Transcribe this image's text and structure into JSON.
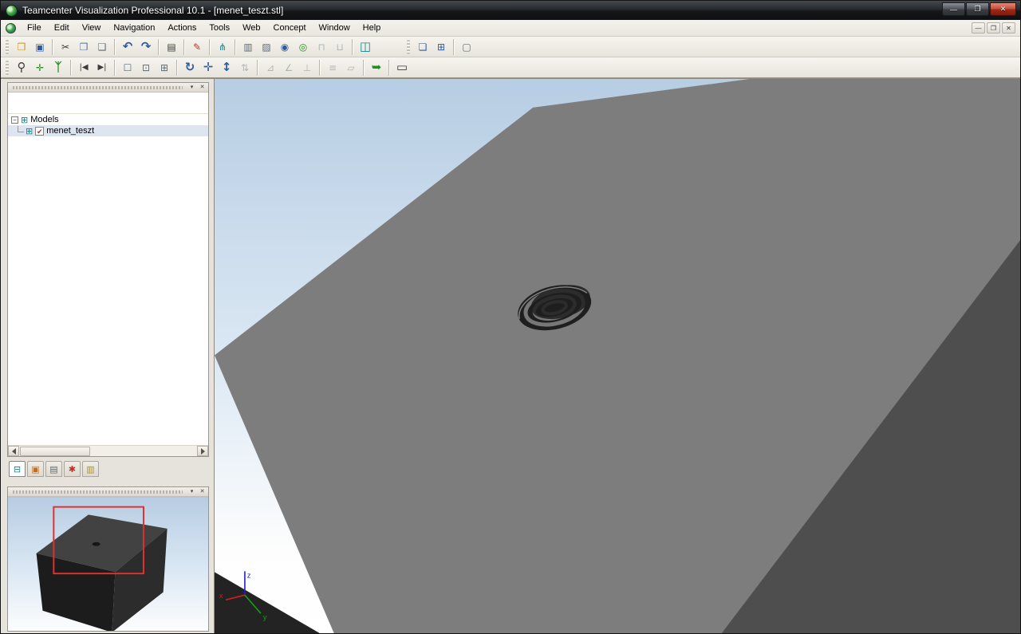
{
  "window": {
    "title": "Teamcenter Visualization Professional 10.1 - [menet_teszt.stl]",
    "controls": {
      "minimize": "—",
      "maximize": "❐",
      "close": "✕"
    }
  },
  "menu": {
    "items": [
      "File",
      "Edit",
      "View",
      "Navigation",
      "Actions",
      "Tools",
      "Web",
      "Concept",
      "Window",
      "Help"
    ],
    "mdi": {
      "minimize": "—",
      "restore": "❐",
      "close": "✕"
    }
  },
  "toolbar_main": {
    "buttons": [
      {
        "name": "open",
        "glyph": "❒"
      },
      {
        "name": "save",
        "glyph": "▣"
      },
      {
        "name": "cut",
        "glyph": "✂"
      },
      {
        "name": "copy",
        "glyph": "❐"
      },
      {
        "name": "paste",
        "glyph": "❑"
      },
      {
        "name": "undo",
        "glyph": "↶"
      },
      {
        "name": "redo",
        "glyph": "↷"
      },
      {
        "name": "print",
        "glyph": "▤"
      },
      {
        "name": "markup",
        "glyph": "✎"
      },
      {
        "name": "product-structure",
        "glyph": "⋔"
      },
      {
        "name": "section",
        "glyph": "▥"
      },
      {
        "name": "compare",
        "glyph": "▨"
      },
      {
        "name": "orbit-sphere",
        "glyph": "◉"
      },
      {
        "name": "examine-sphere",
        "glyph": "◎"
      },
      {
        "name": "lock",
        "glyph": "⊓"
      },
      {
        "name": "unlock",
        "glyph": "⊔"
      },
      {
        "name": "library",
        "glyph": "◫"
      },
      {
        "name": "print-preview",
        "glyph": "❏"
      },
      {
        "name": "print-pages",
        "glyph": "⊞"
      },
      {
        "name": "snapshot",
        "glyph": "▢"
      }
    ]
  },
  "toolbar_view": {
    "buttons": [
      {
        "name": "zoom-select",
        "glyph": "⚲"
      },
      {
        "name": "seek",
        "glyph": "✛"
      },
      {
        "name": "walk",
        "glyph": "ᛉ"
      },
      {
        "name": "previous-view",
        "glyph": "|◀"
      },
      {
        "name": "next-view",
        "glyph": "▶|"
      },
      {
        "name": "zoom-area",
        "glyph": "☐"
      },
      {
        "name": "zoom-window",
        "glyph": "⊡"
      },
      {
        "name": "fit-view",
        "glyph": "⊞"
      },
      {
        "name": "rotate",
        "glyph": "↻"
      },
      {
        "name": "pan",
        "glyph": "✛"
      },
      {
        "name": "zoom",
        "glyph": "↕"
      },
      {
        "name": "fly",
        "glyph": "⇅"
      },
      {
        "name": "measure-distance",
        "glyph": "⊿"
      },
      {
        "name": "measure-angle",
        "glyph": "∠"
      },
      {
        "name": "measure-perpendicular",
        "glyph": "⊥"
      },
      {
        "name": "markup-list",
        "glyph": "≡"
      },
      {
        "name": "views-list",
        "glyph": "▱"
      },
      {
        "name": "refresh-view",
        "glyph": "➥"
      },
      {
        "name": "full-screen",
        "glyph": "▭"
      }
    ]
  },
  "sidebar": {
    "tree": {
      "collapse": "▾",
      "close": "✕",
      "expander": "−",
      "root_icon": "⊞",
      "root": "Models",
      "item_icon": "⊞",
      "check": "✔",
      "item": "menet_teszt"
    },
    "tabs": [
      {
        "name": "structure",
        "glyph": "⊟"
      },
      {
        "name": "thumbnail",
        "glyph": "▣"
      },
      {
        "name": "document",
        "glyph": "▤"
      },
      {
        "name": "links",
        "glyph": "✱"
      },
      {
        "name": "layers",
        "glyph": "▥"
      }
    ],
    "overview": {
      "collapse": "▾",
      "close": "✕"
    }
  },
  "viewport": {
    "axes": {
      "x": "x",
      "y": "y",
      "z": "z"
    },
    "colors": {
      "sky_top": "#b7cde3",
      "sky_mid": "#dbe8f4",
      "sky_bottom": "#fdfdfd",
      "top_face": "#7d7d7d",
      "side_face": "#4e4e4e",
      "front_face": "#232323",
      "hole_dark": "#1f1f1f",
      "thread": "#777777",
      "rim": "#9a9a9a",
      "axis_x": "#cc2020",
      "axis_y": "#14a014",
      "axis_z": "#2020cc"
    }
  },
  "overview_view": {
    "colors": {
      "cube_top": "#424242",
      "cube_front": "#1c1c1c",
      "cube_side": "#2c2c2c",
      "frustum": "#e03030"
    }
  }
}
